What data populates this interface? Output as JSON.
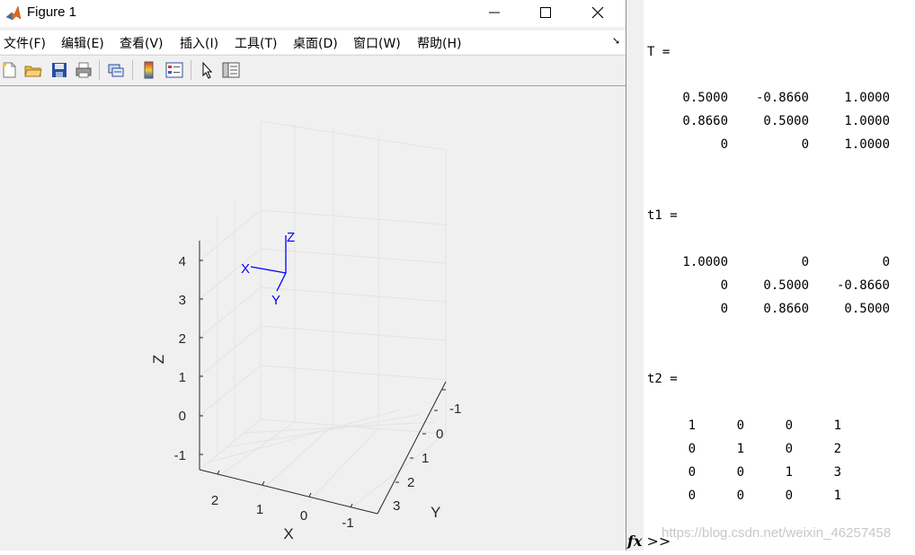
{
  "window": {
    "title": "Figure 1"
  },
  "menu": [
    "文件(F)",
    "编辑(E)",
    "查看(V)",
    "插入(I)",
    "工具(T)",
    "桌面(D)",
    "窗口(W)",
    "帮助(H)"
  ],
  "toolbar_icons": [
    "new-figure-icon",
    "open-file-icon",
    "save-icon",
    "print-icon",
    "link-plot-icon",
    "colorbar-icon",
    "legend-icon",
    "select-cursor-icon",
    "property-inspector-icon"
  ],
  "plot": {
    "z_ticks": [
      "4",
      "3",
      "2",
      "1",
      "0",
      "-1"
    ],
    "x_ticks": [
      "2",
      "1",
      "0",
      "-1"
    ],
    "y_ticks": [
      "-1",
      "0",
      "1",
      "2",
      "3"
    ],
    "xlabel": "X",
    "ylabel": "Y",
    "zlabel": "Z",
    "frame_labels": {
      "x": "X",
      "y": "Y",
      "z": "Z"
    },
    "frame_color": "#0000ff"
  },
  "command_window": {
    "T": {
      "name": "T =",
      "rows": [
        [
          "0.5000",
          "-0.8660",
          "1.0000"
        ],
        [
          "0.8660",
          "0.5000",
          "1.0000"
        ],
        [
          "0",
          "0",
          "1.0000"
        ]
      ]
    },
    "t1": {
      "name": "t1 =",
      "rows": [
        [
          "1.0000",
          "0",
          "0"
        ],
        [
          "0",
          "0.5000",
          "-0.8660"
        ],
        [
          "0",
          "0.8660",
          "0.5000"
        ]
      ]
    },
    "t2": {
      "name": "t2 =",
      "rows": [
        [
          "1",
          "0",
          "0",
          "1"
        ],
        [
          "0",
          "1",
          "0",
          "2"
        ],
        [
          "0",
          "0",
          "1",
          "3"
        ],
        [
          "0",
          "0",
          "0",
          "1"
        ]
      ]
    },
    "prompt": ">>",
    "fx": "fx",
    "watermark": "https://blog.csdn.net/weixin_46257458"
  }
}
